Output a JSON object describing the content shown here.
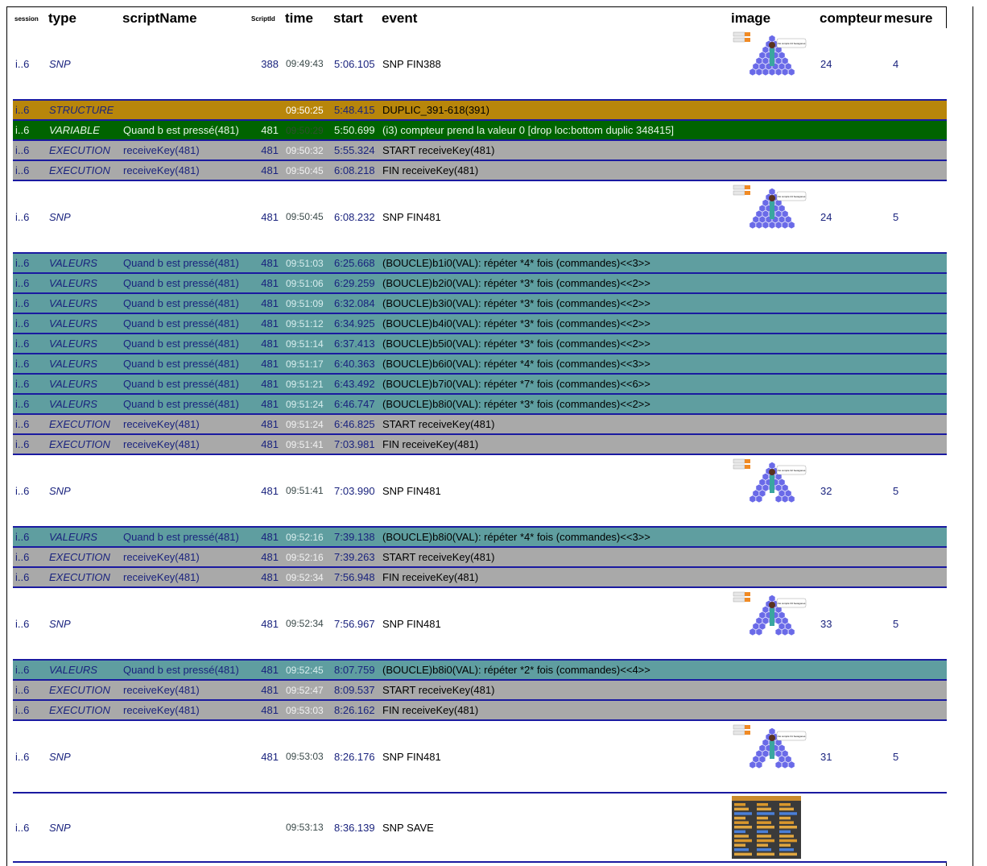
{
  "headers": {
    "session": "session",
    "type": "type",
    "scriptName": "scriptName",
    "scriptId": "ScriptId",
    "time": "time",
    "start": "start",
    "event": "event",
    "image": "image",
    "compteur": "compteur",
    "mesure": "mesure"
  },
  "rows": [
    {
      "session": "i..6",
      "type": "SNP",
      "scriptName": "",
      "scriptId": "388",
      "time": "09:49:43",
      "start": "5:06.105",
      "event": "SNP FIN388",
      "image": "hexagon-pyramid-thumbnail",
      "compteur": "24",
      "mesure": "4",
      "bubble": "J'ai compté 24 hexagones"
    },
    {
      "session": "i..6",
      "type": "STRUCTURE",
      "scriptName": "",
      "scriptId": "",
      "time": "09:50:25",
      "start": "5:48.415",
      "event": "DUPLIC_391-618(391)"
    },
    {
      "session": "i..6",
      "type": "VARIABLE",
      "scriptName": "Quand b est pressé(481)",
      "scriptId": "481",
      "time": "09:50:29",
      "start": "5:50.699",
      "event": "(i3) compteur prend la valeur 0 [drop loc:bottom duplic 348415]"
    },
    {
      "session": "i..6",
      "type": "EXECUTION",
      "scriptName": "receiveKey(481)",
      "scriptId": "481",
      "time": "09:50:32",
      "start": "5:55.324",
      "event": "START receiveKey(481)"
    },
    {
      "session": "i..6",
      "type": "EXECUTION",
      "scriptName": "receiveKey(481)",
      "scriptId": "481",
      "time": "09:50:45",
      "start": "6:08.218",
      "event": "FIN receiveKey(481)"
    },
    {
      "session": "i..6",
      "type": "SNP",
      "scriptName": "",
      "scriptId": "481",
      "time": "09:50:45",
      "start": "6:08.232",
      "event": "SNP FIN481",
      "image": "hexagon-pyramid-thumbnail",
      "compteur": "24",
      "mesure": "5",
      "bubble": "J'ai compté 24 hexagones"
    },
    {
      "session": "i..6",
      "type": "VALEURS",
      "scriptName": "Quand b est pressé(481)",
      "scriptId": "481",
      "time": "09:51:03",
      "start": "6:25.668",
      "event": "(BOUCLE)b1i0(VAL): répéter *4* fois (commandes)<<3>>"
    },
    {
      "session": "i..6",
      "type": "VALEURS",
      "scriptName": "Quand b est pressé(481)",
      "scriptId": "481",
      "time": "09:51:06",
      "start": "6:29.259",
      "event": "(BOUCLE)b2i0(VAL): répéter *3* fois (commandes)<<2>>"
    },
    {
      "session": "i..6",
      "type": "VALEURS",
      "scriptName": "Quand b est pressé(481)",
      "scriptId": "481",
      "time": "09:51:09",
      "start": "6:32.084",
      "event": "(BOUCLE)b3i0(VAL): répéter *3* fois (commandes)<<2>>"
    },
    {
      "session": "i..6",
      "type": "VALEURS",
      "scriptName": "Quand b est pressé(481)",
      "scriptId": "481",
      "time": "09:51:12",
      "start": "6:34.925",
      "event": "(BOUCLE)b4i0(VAL): répéter *3* fois (commandes)<<2>>"
    },
    {
      "session": "i..6",
      "type": "VALEURS",
      "scriptName": "Quand b est pressé(481)",
      "scriptId": "481",
      "time": "09:51:14",
      "start": "6:37.413",
      "event": "(BOUCLE)b5i0(VAL): répéter *3* fois (commandes)<<2>>"
    },
    {
      "session": "i..6",
      "type": "VALEURS",
      "scriptName": "Quand b est pressé(481)",
      "scriptId": "481",
      "time": "09:51:17",
      "start": "6:40.363",
      "event": "(BOUCLE)b6i0(VAL): répéter *4* fois (commandes)<<3>>"
    },
    {
      "session": "i..6",
      "type": "VALEURS",
      "scriptName": "Quand b est pressé(481)",
      "scriptId": "481",
      "time": "09:51:21",
      "start": "6:43.492",
      "event": "(BOUCLE)b7i0(VAL): répéter *7* fois (commandes)<<6>>"
    },
    {
      "session": "i..6",
      "type": "VALEURS",
      "scriptName": "Quand b est pressé(481)",
      "scriptId": "481",
      "time": "09:51:24",
      "start": "6:46.747",
      "event": "(BOUCLE)b8i0(VAL): répéter *3* fois (commandes)<<2>>"
    },
    {
      "session": "i..6",
      "type": "EXECUTION",
      "scriptName": "receiveKey(481)",
      "scriptId": "481",
      "time": "09:51:24",
      "start": "6:46.825",
      "event": "START receiveKey(481)"
    },
    {
      "session": "i..6",
      "type": "EXECUTION",
      "scriptName": "receiveKey(481)",
      "scriptId": "481",
      "time": "09:51:41",
      "start": "7:03.981",
      "event": "FIN receiveKey(481)"
    },
    {
      "session": "i..6",
      "type": "SNP",
      "scriptName": "",
      "scriptId": "481",
      "time": "09:51:41",
      "start": "7:03.990",
      "event": "SNP FIN481",
      "image": "hexagon-pyramid-thumbnail",
      "compteur": "32",
      "mesure": "5",
      "bubble": "J'ai compté 32 hexagones"
    },
    {
      "session": "i..6",
      "type": "VALEURS",
      "scriptName": "Quand b est pressé(481)",
      "scriptId": "481",
      "time": "09:52:16",
      "start": "7:39.138",
      "event": "(BOUCLE)b8i0(VAL): répéter *4* fois (commandes)<<3>>"
    },
    {
      "session": "i..6",
      "type": "EXECUTION",
      "scriptName": "receiveKey(481)",
      "scriptId": "481",
      "time": "09:52:16",
      "start": "7:39.263",
      "event": "START receiveKey(481)"
    },
    {
      "session": "i..6",
      "type": "EXECUTION",
      "scriptName": "receiveKey(481)",
      "scriptId": "481",
      "time": "09:52:34",
      "start": "7:56.948",
      "event": "FIN receiveKey(481)"
    },
    {
      "session": "i..6",
      "type": "SNP",
      "scriptName": "",
      "scriptId": "481",
      "time": "09:52:34",
      "start": "7:56.967",
      "event": "SNP FIN481",
      "image": "hexagon-pyramid-thumbnail",
      "compteur": "33",
      "mesure": "5",
      "bubble": "J'ai compté 33 hexagones"
    },
    {
      "session": "i..6",
      "type": "VALEURS",
      "scriptName": "Quand b est pressé(481)",
      "scriptId": "481",
      "time": "09:52:45",
      "start": "8:07.759",
      "event": "(BOUCLE)b8i0(VAL): répéter *2* fois (commandes)<<4>>"
    },
    {
      "session": "i..6",
      "type": "EXECUTION",
      "scriptName": "receiveKey(481)",
      "scriptId": "481",
      "time": "09:52:47",
      "start": "8:09.537",
      "event": "START receiveKey(481)"
    },
    {
      "session": "i..6",
      "type": "EXECUTION",
      "scriptName": "receiveKey(481)",
      "scriptId": "481",
      "time": "09:53:03",
      "start": "8:26.162",
      "event": "FIN receiveKey(481)"
    },
    {
      "session": "i..6",
      "type": "SNP",
      "scriptName": "",
      "scriptId": "481",
      "time": "09:53:03",
      "start": "8:26.176",
      "event": "SNP FIN481",
      "image": "hexagon-pyramid-thumbnail",
      "compteur": "31",
      "mesure": "5",
      "bubble": "J'ai compté 31 hexagones"
    },
    {
      "session": "i..6",
      "type": "SNP",
      "scriptName": "",
      "scriptId": "",
      "time": "09:53:13",
      "start": "8:36.139",
      "event": "SNP SAVE",
      "image": "script-editor-thumbnail",
      "compteur": "",
      "mesure": ""
    }
  ],
  "colors": {
    "STRUCTURE": "#b8860b",
    "VARIABLE": "#006400",
    "EXECUTION": "#a9a9a9",
    "VALEURS": "#5f9ea0",
    "SNP": "#ffffff",
    "hexagon": "#6a6ae8",
    "row_border": "#1a1aa0"
  }
}
